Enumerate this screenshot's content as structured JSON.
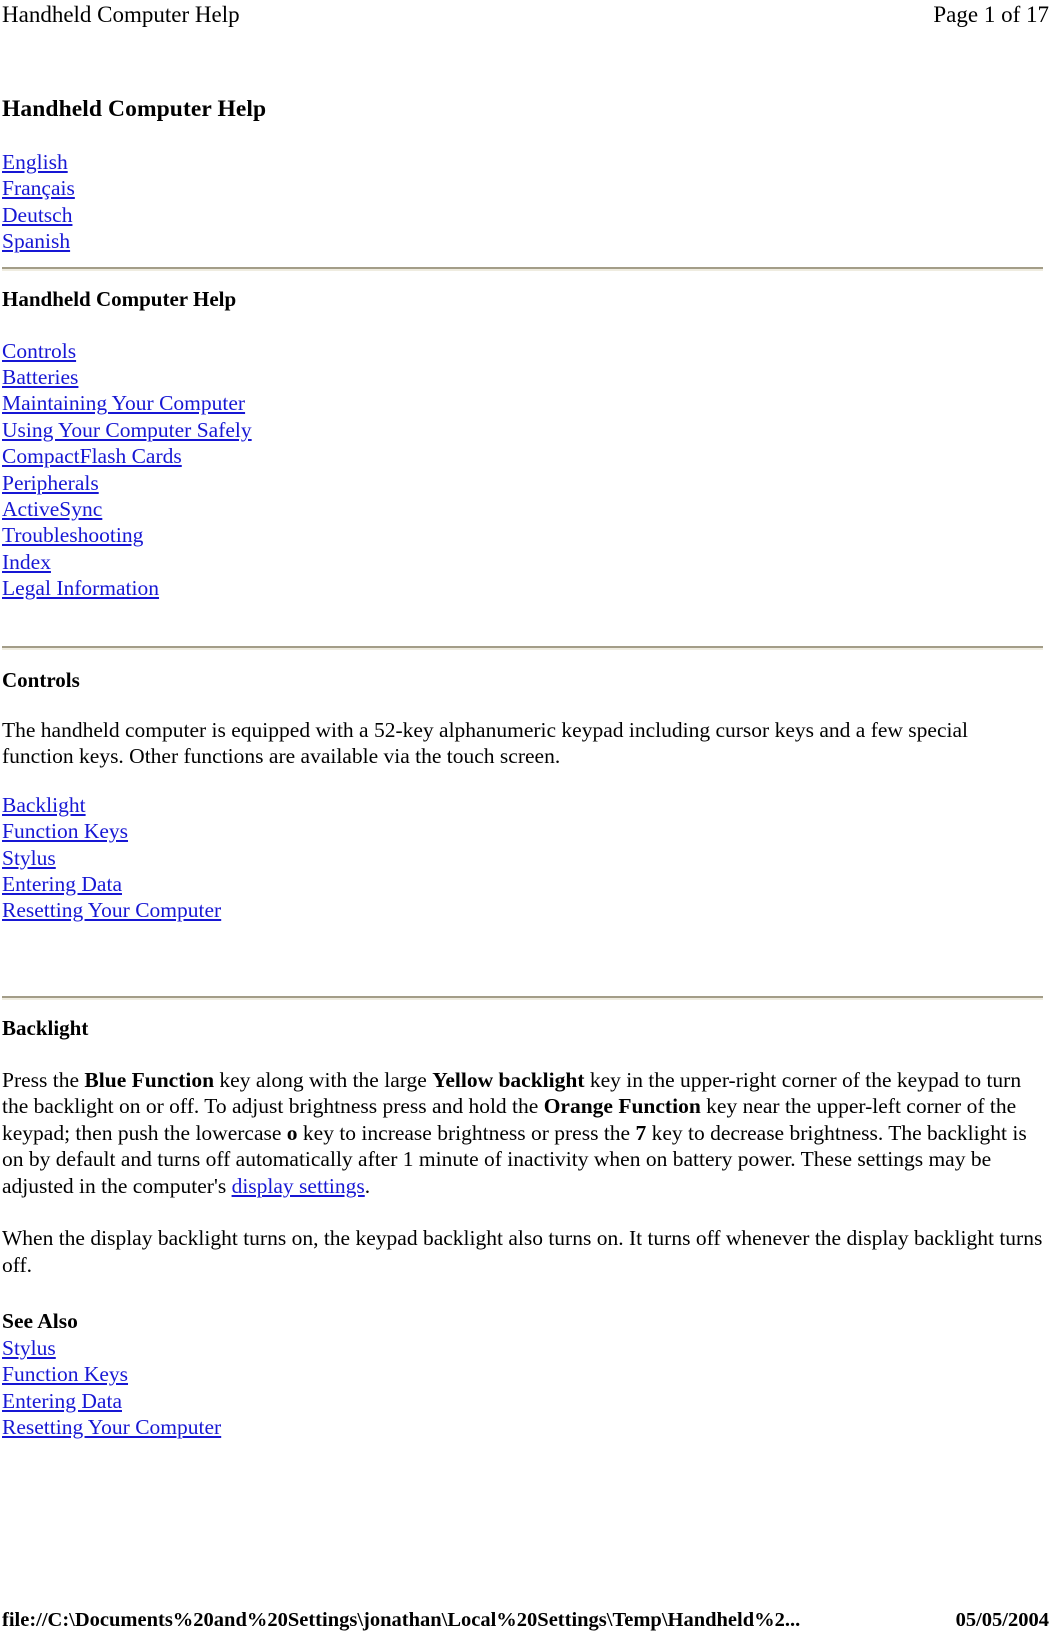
{
  "header": {
    "title": "Handheld Computer Help",
    "page_label": "Page 1 of 17"
  },
  "doc": {
    "title": "Handheld Computer Help",
    "languages": [
      {
        "label": "English"
      },
      {
        "label": "Français"
      },
      {
        "label": "Deutsch"
      },
      {
        "label": "Spanish"
      }
    ],
    "toc_title": "Handheld Computer Help",
    "toc": [
      {
        "label": "Controls"
      },
      {
        "label": "Batteries"
      },
      {
        "label": "Maintaining Your Computer"
      },
      {
        "label": "Using Your Computer Safely"
      },
      {
        "label": "CompactFlash Cards"
      },
      {
        "label": "Peripherals"
      },
      {
        "label": "ActiveSync"
      },
      {
        "label": "Troubleshooting"
      },
      {
        "label": "Index"
      },
      {
        "label": "Legal Information"
      }
    ]
  },
  "controls": {
    "heading": "Controls",
    "paragraph": "The handheld computer is equipped with a 52-key alphanumeric keypad including cursor keys and a few special function keys. Other functions are available via the touch screen.",
    "links": [
      {
        "label": "Backlight"
      },
      {
        "label": "Function Keys"
      },
      {
        "label": "Stylus"
      },
      {
        "label": "Entering Data"
      },
      {
        "label": "Resetting Your Computer"
      }
    ]
  },
  "backlight": {
    "heading": "Backlight",
    "p1": {
      "t1": "Press the ",
      "b1": "Blue Function",
      "t2": " key along with the large ",
      "b2": "Yellow backlight",
      "t3": " key in the upper-right corner of the keypad to turn the backlight on or off. To adjust brightness press and hold the ",
      "b3": "Orange Function",
      "t4": " key near the upper-left corner of the keypad; then push the lowercase ",
      "b4": "o",
      "t5": " key to increase brightness or press the ",
      "b5": "7",
      "t6": " key to decrease brightness. The backlight is on by default and turns off automatically after 1 minute of inactivity when on battery power. These settings may be adjusted in the computer's ",
      "link": "display settings",
      "t7": "."
    },
    "p2": "When the display backlight turns on, the keypad backlight also turns on. It turns off whenever the display backlight turns off.",
    "see_also_label": "See Also",
    "see_also": [
      {
        "label": "Stylus"
      },
      {
        "label": "Function Keys"
      },
      {
        "label": "Entering Data"
      },
      {
        "label": "Resetting Your Computer"
      }
    ]
  },
  "footer": {
    "url": "file://C:\\Documents%20and%20Settings\\jonathan\\Local%20Settings\\Temp\\Handheld%2...",
    "date": "05/05/2004"
  },
  "colors": {
    "link": "#1717d4",
    "rule_dark": "#a39d88",
    "rule_light": "#efece0",
    "text": "#000000",
    "background": "#ffffff"
  }
}
